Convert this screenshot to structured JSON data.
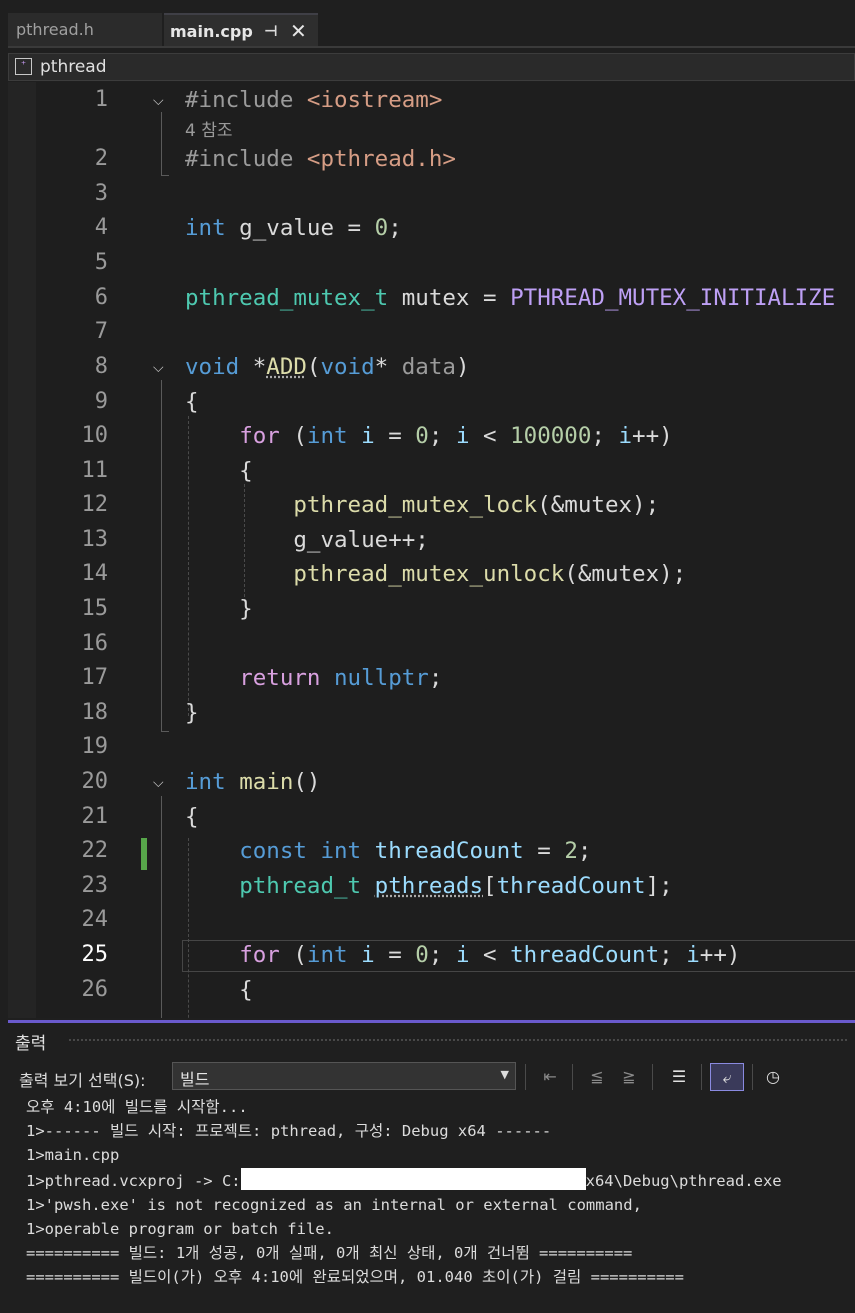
{
  "tabs": [
    {
      "label": "pthread.h",
      "active": false
    },
    {
      "label": "main.cpp",
      "active": true
    }
  ],
  "tab_pin_icon": "pin-icon",
  "tab_close_icon": "close-icon",
  "navbar": {
    "label": "pthread",
    "icon": "project-icon"
  },
  "editor": {
    "active_line": 25,
    "changed_line": 22,
    "codelens_line2": "4 참조",
    "lines": [
      {
        "n": "1",
        "text": "#include <iostream>"
      },
      {
        "n": "2",
        "text": "#include <pthread.h>"
      },
      {
        "n": "3",
        "text": ""
      },
      {
        "n": "4",
        "text": "int g_value = 0;"
      },
      {
        "n": "5",
        "text": ""
      },
      {
        "n": "6",
        "text": "pthread_mutex_t mutex = PTHREAD_MUTEX_INITIALIZE"
      },
      {
        "n": "7",
        "text": ""
      },
      {
        "n": "8",
        "text": "void *ADD(void* data)"
      },
      {
        "n": "9",
        "text": "{"
      },
      {
        "n": "10",
        "text": "    for (int i = 0; i < 100000; i++)"
      },
      {
        "n": "11",
        "text": "    {"
      },
      {
        "n": "12",
        "text": "        pthread_mutex_lock(&mutex);"
      },
      {
        "n": "13",
        "text": "        g_value++;"
      },
      {
        "n": "14",
        "text": "        pthread_mutex_unlock(&mutex);"
      },
      {
        "n": "15",
        "text": "    }"
      },
      {
        "n": "16",
        "text": ""
      },
      {
        "n": "17",
        "text": "    return nullptr;"
      },
      {
        "n": "18",
        "text": "}"
      },
      {
        "n": "19",
        "text": ""
      },
      {
        "n": "20",
        "text": "int main()"
      },
      {
        "n": "21",
        "text": "{"
      },
      {
        "n": "22",
        "text": "    const int threadCount = 2;"
      },
      {
        "n": "23",
        "text": "    pthread_t pthreads[threadCount];"
      },
      {
        "n": "24",
        "text": ""
      },
      {
        "n": "25",
        "text": "    for (int i = 0; i < threadCount; i++)"
      },
      {
        "n": "26",
        "text": "    {"
      }
    ]
  },
  "output": {
    "title": "출력",
    "select_label": "출력 보기 선택(S):",
    "select_value": "빌드",
    "toolbar_icons": [
      "find-message-icon",
      "prev-message-icon",
      "next-message-icon",
      "clear-all-icon",
      "word-wrap-icon",
      "history-icon"
    ],
    "lines": [
      "오후 4:10에 빌드를 시작함...",
      "1>------ 빌드 시작: 프로젝트: pthread, 구성: Debug x64 ------",
      "1>main.cpp",
      "1>pthread.vcxproj -> C:",
      "x64\\Debug\\pthread.exe",
      "1>'pwsh.exe' is not recognized as an internal or external command,",
      "1>operable program or batch file.",
      "========== 빌드: 1개 성공, 0개 실패, 0개 최신 상태, 0개 건너뜀 ==========",
      "========== 빌드이(가) 오후 4:10에 완료되었으며, 01.040 초이(가) 걸림 =========="
    ]
  },
  "colors": {
    "accent": "#6a5acd",
    "change_marker": "#57a64a"
  }
}
